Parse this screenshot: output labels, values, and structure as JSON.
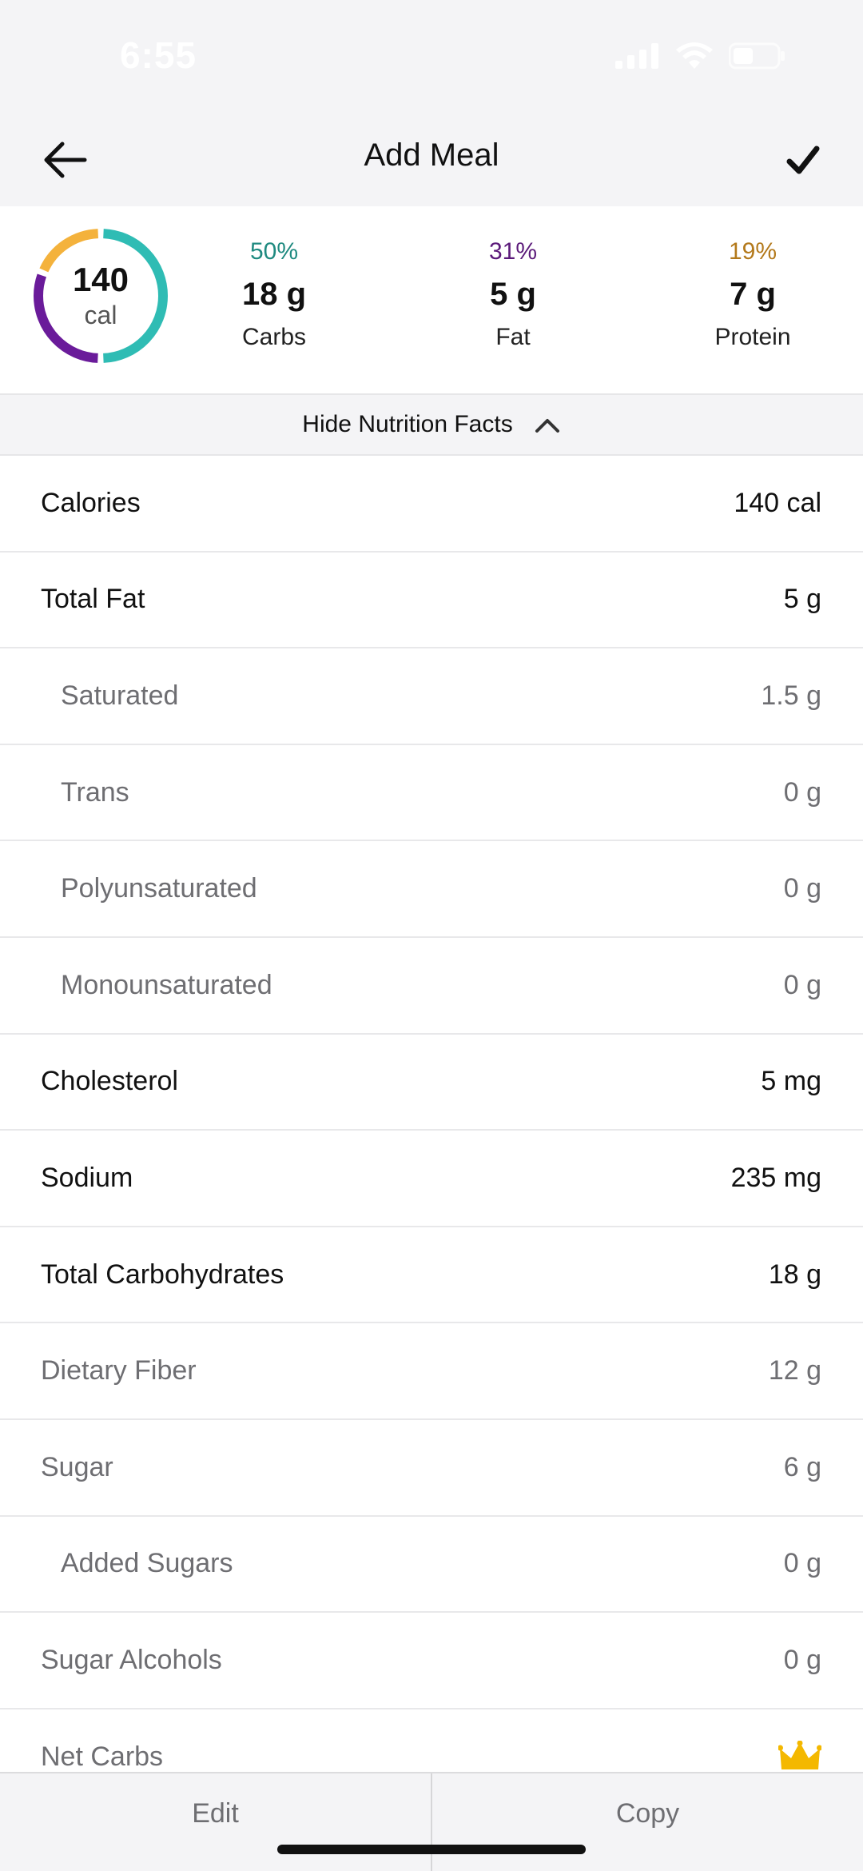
{
  "status_bar": {
    "time": "6:55"
  },
  "header": {
    "title": "Add Meal"
  },
  "summary": {
    "calories": "140",
    "calories_unit": "cal",
    "ring_fractions": {
      "carbs": 0.5,
      "fat": 0.31,
      "protein": 0.19
    },
    "macros": [
      {
        "percent": "50%",
        "grams": "18 g",
        "label": "Carbs",
        "color": "#1f8a80"
      },
      {
        "percent": "31%",
        "grams": "5 g",
        "label": "Fat",
        "color": "#5b1a7a"
      },
      {
        "percent": "19%",
        "grams": "7 g",
        "label": "Protein",
        "color": "#b3791b"
      }
    ],
    "ring_colors": {
      "carbs": "#2fbcb4",
      "fat": "#6a1b9a",
      "protein": "#f4b23c"
    }
  },
  "toggle": {
    "label": "Hide Nutrition Facts",
    "icon": "chevron-up-icon"
  },
  "nutrition": [
    {
      "label": "Calories",
      "value": "140 cal"
    },
    {
      "label": "Total Fat",
      "value": "5 g"
    },
    {
      "label": "Saturated",
      "value": "1.5 g"
    },
    {
      "label": "Trans",
      "value": "0 g"
    },
    {
      "label": "Polyunsaturated",
      "value": "0 g"
    },
    {
      "label": "Monounsaturated",
      "value": "0 g"
    },
    {
      "label": "Cholesterol",
      "value": "5 mg"
    },
    {
      "label": "Sodium",
      "value": "235 mg"
    },
    {
      "label": "Total Carbohydrates",
      "value": "18 g"
    },
    {
      "label": "Dietary Fiber",
      "value": "12 g"
    },
    {
      "label": "Sugar",
      "value": "6 g"
    },
    {
      "label": "Added Sugars",
      "value": "0 g"
    },
    {
      "label": "Sugar Alcohols",
      "value": "0 g"
    },
    {
      "label": "Net Carbs",
      "value": "",
      "icon": "crown-icon"
    }
  ],
  "bottom_bar": {
    "edit_label": "Edit",
    "copy_label": "Copy"
  },
  "accent_colors": {
    "premium_crown": "#f4b800"
  }
}
